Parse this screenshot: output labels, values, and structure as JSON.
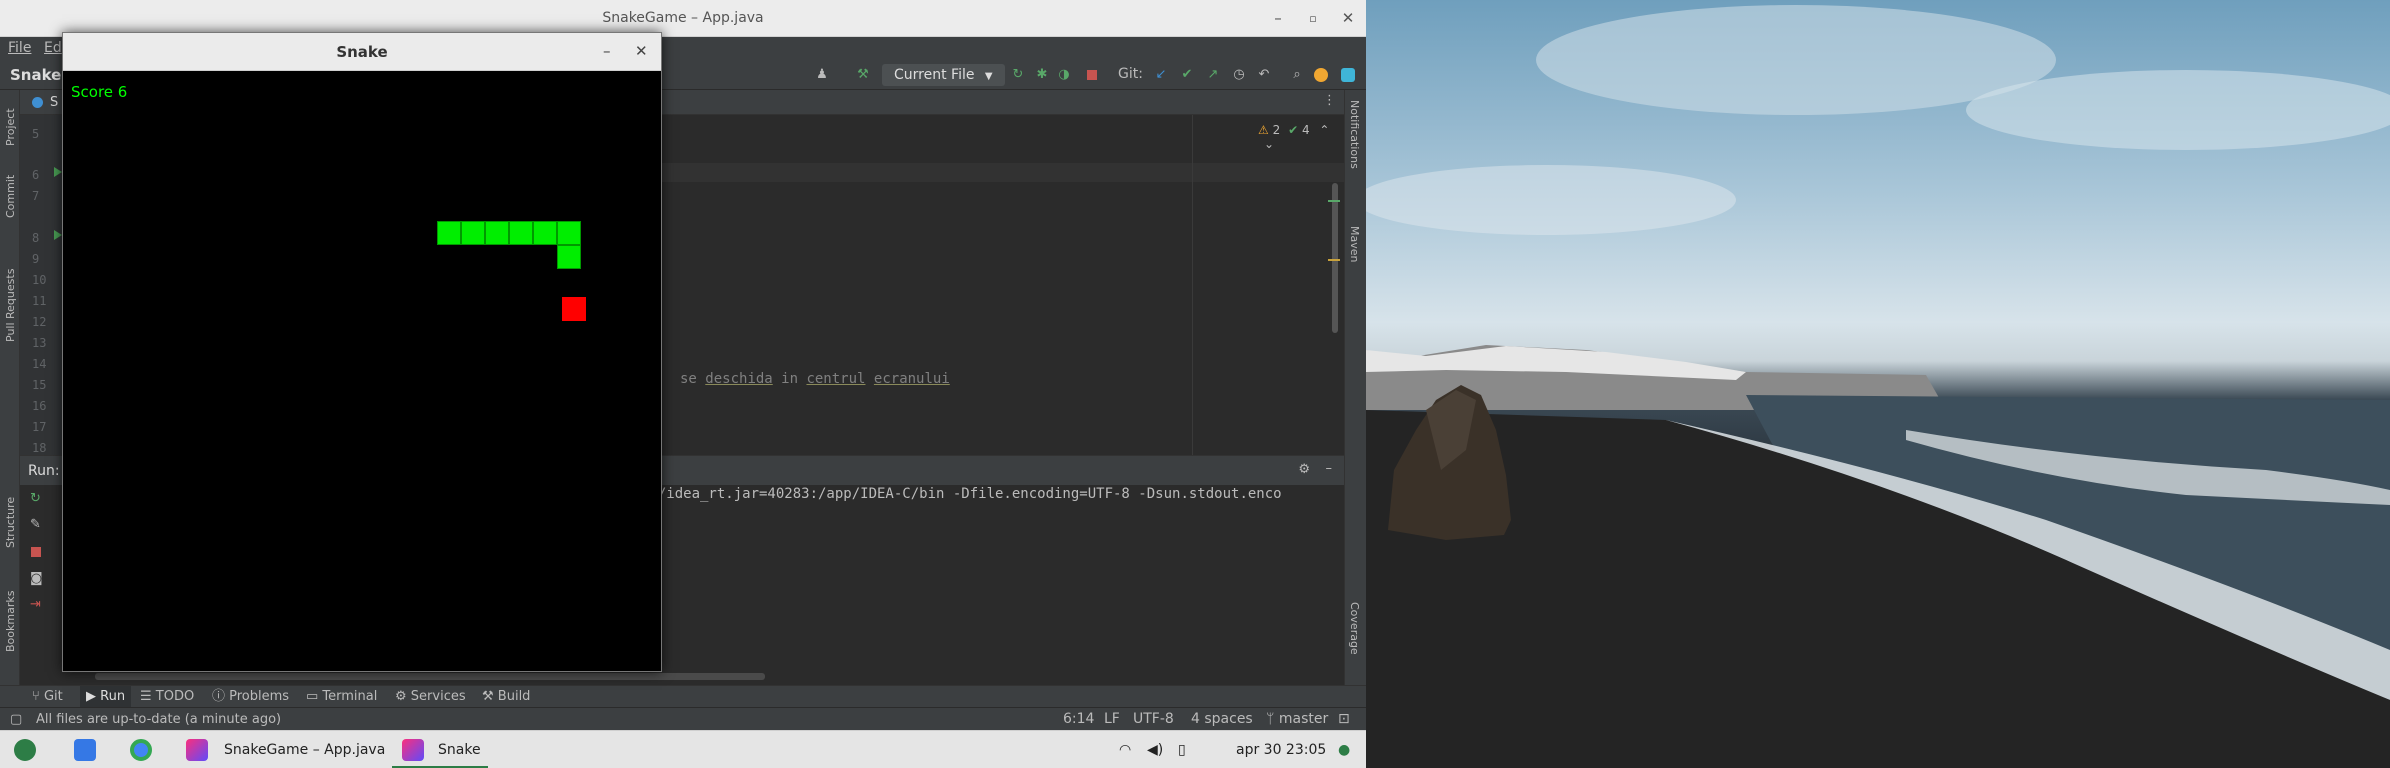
{
  "ide": {
    "window_title": "SnakeGame – App.java",
    "menu": [
      "File",
      "Ed"
    ],
    "project_name": "Snake",
    "run_config": "Current File",
    "git_label": "Git:",
    "inspection": {
      "warnings": "2",
      "checks": "4"
    },
    "line_numbers": [
      "5",
      "6",
      "7",
      "8",
      "9",
      "10",
      "11",
      "12",
      "13",
      "14",
      "15",
      "16",
      "17",
      "18"
    ],
    "code_fragment": {
      "pre": "se ",
      "w1": "deschida",
      "mid1": " in ",
      "w2": "centrul",
      "mid2": " ",
      "w3": "ecranului"
    },
    "run_panel_label": "Run:",
    "run_output": "ib/idea_rt.jar=40283:/app/IDEA-C/bin -Dfile.encoding=UTF-8 -Dsun.stdout.enco",
    "left_tools": [
      "Project",
      "Commit",
      "Pull Requests",
      "Structure",
      "Bookmarks"
    ],
    "right_tools": [
      "Notifications",
      "Maven",
      "Coverage"
    ],
    "bottom_tabs": [
      "Git",
      "Run",
      "TODO",
      "Problems",
      "Terminal",
      "Services",
      "Build"
    ],
    "status_message": "All files are up-to-date (a minute ago)",
    "status": {
      "position": "6:14",
      "line_sep": "LF",
      "encoding": "UTF-8",
      "indent": "4 spaces",
      "branch": "master"
    }
  },
  "snake_window": {
    "title": "Snake",
    "score_text": "Score 6",
    "snake_color": "#00ee00",
    "food_color": "#ff0000"
  },
  "taskbar": {
    "apps": [
      {
        "label": "SnakeGame – App.java",
        "icon": "intellij-icon"
      },
      {
        "label": "Snake",
        "icon": "intellij-icon"
      }
    ],
    "clock": "apr 30  23:05"
  },
  "colors": {
    "ide_bg": "#2b2b2b",
    "ide_panel": "#3c3f41",
    "accent_green": "#499c54"
  }
}
